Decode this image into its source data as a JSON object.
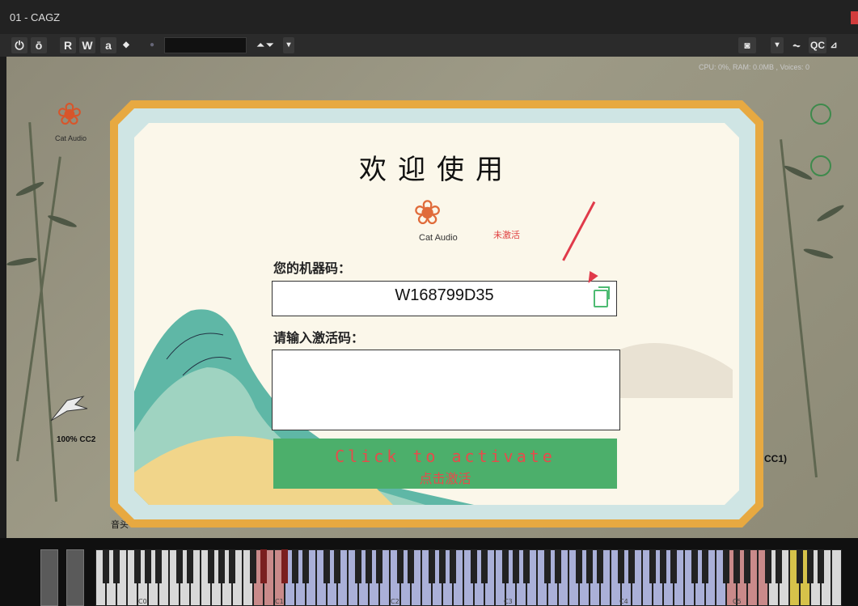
{
  "window": {
    "title": "01 - CAGZ"
  },
  "toolbar": {
    "power_glyph": "⏻",
    "compare_glyph": "ō",
    "read_label": "R",
    "write_label": "W",
    "a_label": "a",
    "prev_glyph": "◆",
    "preset_arrows": "⏶ ⏷",
    "dropdown_glyph": "▾",
    "camera_glyph": "◙",
    "bypass_glyph": "⏦",
    "qc_label": "QC",
    "lock_glyph": "⊿"
  },
  "status_bar": {
    "cpu_text": "CPU: 0%, RAM: 0.0MB , Voices: 0"
  },
  "instrument": {
    "brand": "Cat Audio",
    "cc2_label": "100% CC2",
    "cc1_label": "CC1)",
    "yin_label": "音头"
  },
  "dialog": {
    "heading": "欢迎使用",
    "brand": "Cat Audio",
    "status": "未激活",
    "machine_code_label": "您的机器码：",
    "machine_code": "W168799D35",
    "activation_label": "请输入激活码：",
    "activation_placeholder": "",
    "activate_button_en": "Click to activate",
    "activate_button_zh": "点击激活"
  },
  "keyboard": {
    "octave_labels": [
      "C0",
      "C1",
      "C2",
      "C3",
      "C4",
      "C5"
    ]
  },
  "colors": {
    "accent_green": "#4caf6b",
    "accent_red": "#e64b4b",
    "frame_gold": "#e7a941",
    "key_red": "#c98a8a",
    "key_blue": "#aab0d8",
    "key_yellow": "#d6c24a"
  }
}
